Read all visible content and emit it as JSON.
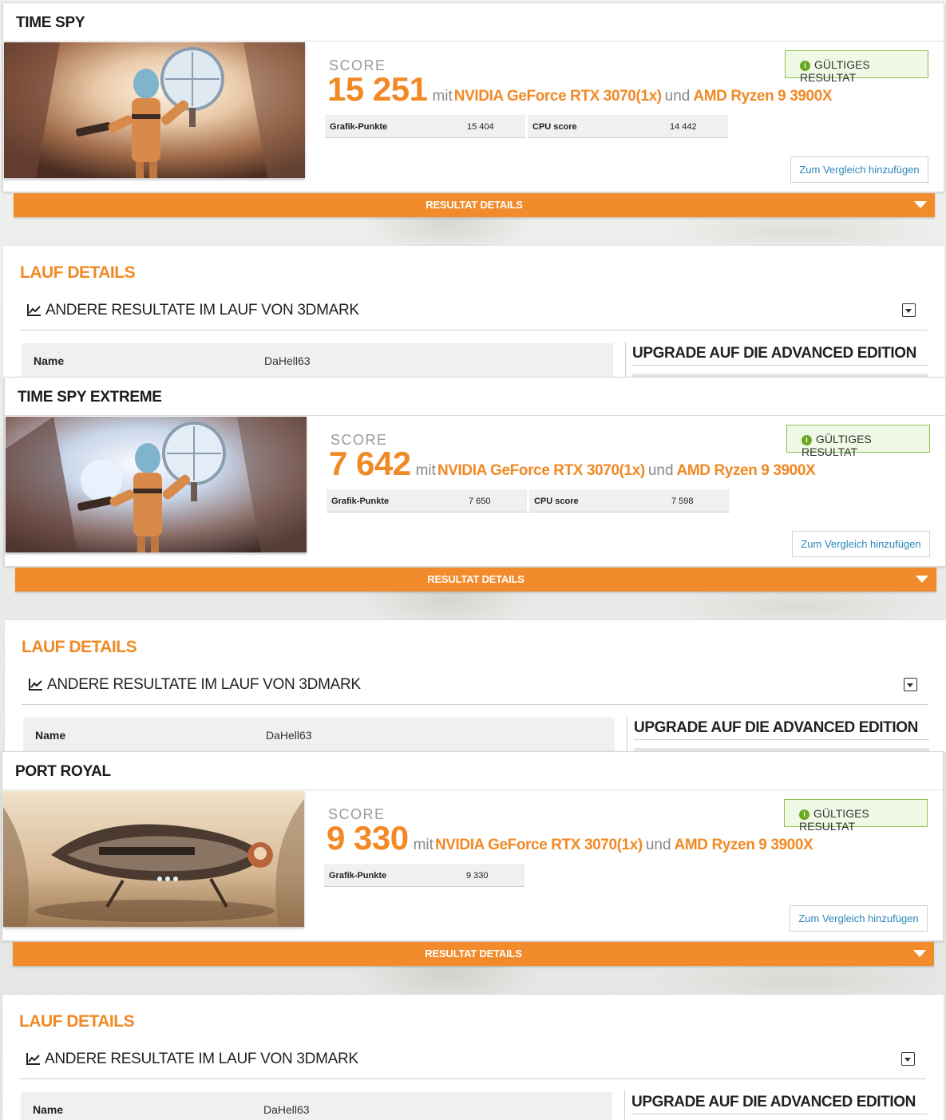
{
  "benchmarks": [
    {
      "title": "TIME SPY",
      "score_label": "SCORE",
      "score": "15 251",
      "with_text": "mit",
      "gpu": "NVIDIA GeForce RTX 3070(1x)",
      "and_text": "und",
      "cpu": "AMD Ryzen 9 3900X",
      "valid_label": "GÜLTIGES RESULTAT",
      "subscores": [
        {
          "name": "Grafik-Punkte",
          "value": "15 404"
        },
        {
          "name": "CPU score",
          "value": "14 442"
        }
      ],
      "compare_label": "Zum Vergleich hinzufügen",
      "details_label": "RESULTAT DETAILS",
      "run_details_title": "LAUF DETAILS",
      "other_results_label": "ANDERE RESULTATE IM LAUF VON 3DMARK",
      "name_key": "Name",
      "name_value": "DaHell63",
      "upgrade_label": "UPGRADE AUF DIE ADVANCED EDITION"
    },
    {
      "title": "TIME SPY EXTREME",
      "score_label": "SCORE",
      "score": "7 642",
      "with_text": "mit",
      "gpu": "NVIDIA GeForce RTX 3070(1x)",
      "and_text": "und",
      "cpu": "AMD Ryzen 9 3900X",
      "valid_label": "GÜLTIGES RESULTAT",
      "subscores": [
        {
          "name": "Grafik-Punkte",
          "value": "7 650"
        },
        {
          "name": "CPU score",
          "value": "7 598"
        }
      ],
      "compare_label": "Zum Vergleich hinzufügen",
      "details_label": "RESULTAT DETAILS",
      "run_details_title": "LAUF DETAILS",
      "other_results_label": "ANDERE RESULTATE IM LAUF VON 3DMARK",
      "name_key": "Name",
      "name_value": "DaHell63",
      "upgrade_label": "UPGRADE AUF DIE ADVANCED EDITION"
    },
    {
      "title": "PORT ROYAL",
      "score_label": "SCORE",
      "score": "9 330",
      "with_text": "mit",
      "gpu": "NVIDIA GeForce RTX 3070(1x)",
      "and_text": "und",
      "cpu": "AMD Ryzen 9 3900X",
      "valid_label": "GÜLTIGES RESULTAT",
      "subscores": [
        {
          "name": "Grafik-Punkte",
          "value": "9 330"
        }
      ],
      "compare_label": "Zum Vergleich hinzufügen",
      "details_label": "RESULTAT DETAILS",
      "run_details_title": "LAUF DETAILS",
      "other_results_label": "ANDERE RESULTATE IM LAUF VON 3DMARK",
      "name_key": "Name",
      "name_value": "DaHell63",
      "upgrade_label": "UPGRADE AUF DIE ADVANCED EDITION"
    }
  ],
  "icons": {
    "valid": "info-circle-icon",
    "details_toggle": "triangle-down-icon",
    "other_results": "line-chart-icon",
    "collapse": "collapse-box-icon"
  },
  "colors": {
    "accent_orange": "#f18925",
    "valid_green": "#8bc34a",
    "link_blue": "#2a87b8"
  }
}
